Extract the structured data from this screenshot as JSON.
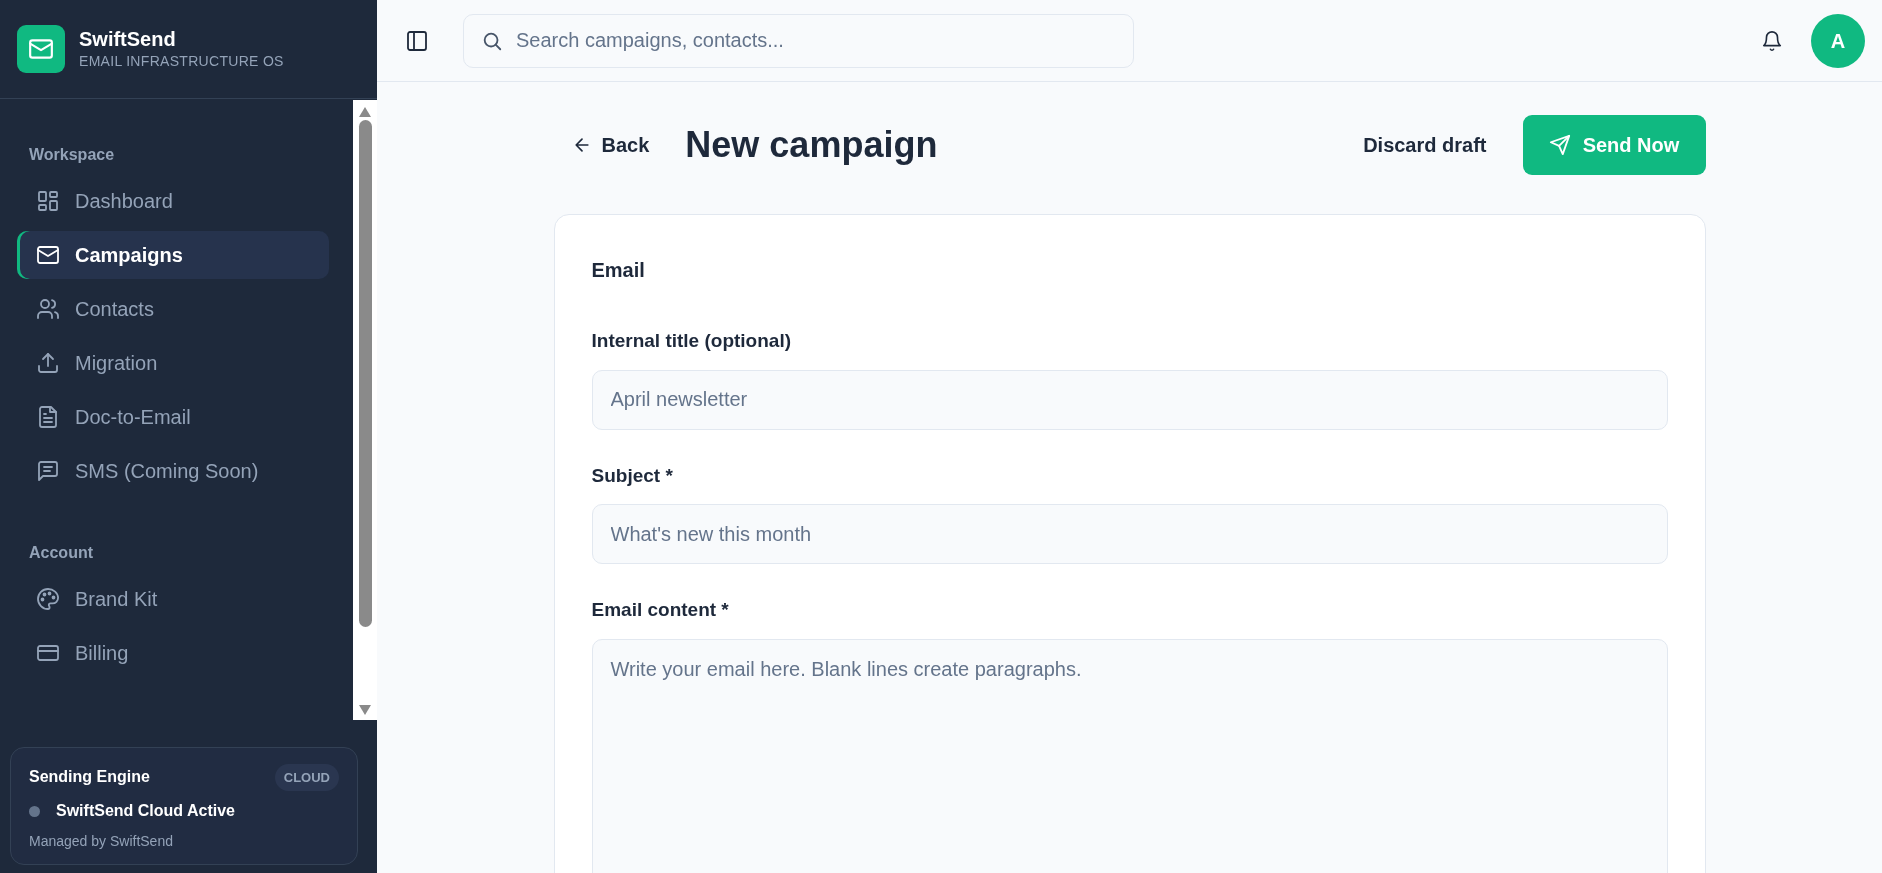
{
  "brand": {
    "name": "SwiftSend",
    "tagline": "EMAIL INFRASTRUCTURE OS"
  },
  "sidebar": {
    "sections": [
      {
        "title": "Workspace",
        "items": [
          {
            "label": "Dashboard",
            "selected": false
          },
          {
            "label": "Campaigns",
            "selected": true
          },
          {
            "label": "Contacts",
            "selected": false
          },
          {
            "label": "Migration",
            "selected": false
          },
          {
            "label": "Doc-to-Email",
            "selected": false
          },
          {
            "label": "SMS (Coming Soon)",
            "selected": false
          }
        ]
      },
      {
        "title": "Account",
        "items": [
          {
            "label": "Brand Kit",
            "selected": false
          },
          {
            "label": "Billing",
            "selected": false
          }
        ]
      }
    ]
  },
  "engine_card": {
    "title": "Sending Engine",
    "badge": "CLOUD",
    "status": "SwiftSend Cloud Active",
    "note": "Managed by SwiftSend"
  },
  "topbar": {
    "search": {
      "placeholder": "Search campaigns, contacts..."
    },
    "avatar": "A"
  },
  "header": {
    "back": "Back",
    "title": "New campaign",
    "discard": "Discard draft",
    "send": "Send Now"
  },
  "form": {
    "section": "Email",
    "fields": [
      {
        "kind": "input",
        "label": "Internal title (optional)",
        "placeholder": "April newsletter"
      },
      {
        "kind": "input",
        "label": "Subject *",
        "placeholder": "What's new this month"
      },
      {
        "kind": "textarea",
        "label": "Email content *",
        "placeholder": "Write your email here. Blank lines create paragraphs."
      }
    ]
  }
}
